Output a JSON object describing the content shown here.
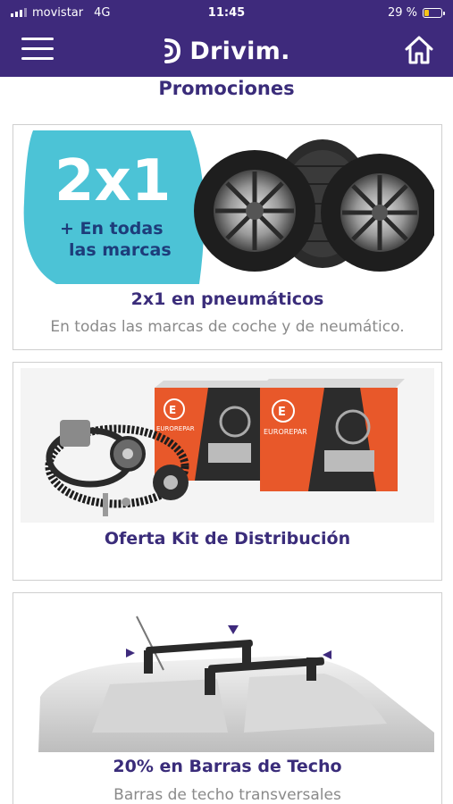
{
  "status_bar": {
    "carrier": "movistar",
    "network": "4G",
    "time": "11:45",
    "battery": "29 %",
    "battery_level": 0.29
  },
  "header": {
    "brand": "Drivim.",
    "menu_icon": "hamburger-menu-icon",
    "home_icon": "home-icon"
  },
  "page": {
    "section_title": "Promociones"
  },
  "promotions": [
    {
      "badge_big": "2x1",
      "badge_line1": "+ En todas",
      "badge_line2": "las marcas",
      "title": "2x1 en pneumáticos",
      "subtitle": "En todas las marcas de coche y de neumático."
    },
    {
      "box_brand": "EUROREPAR",
      "title": "Oferta Kit de Distribución"
    },
    {
      "title": "20% en Barras de Techo",
      "subtitle": "Barras de techo transversales"
    }
  ],
  "colors": {
    "brand_purple": "#3e2a7c",
    "title_purple": "#3a2c7a",
    "badge_cyan": "#4cc3d6",
    "box_orange": "#e8582a",
    "subtitle_gray": "#8a8a8a"
  }
}
